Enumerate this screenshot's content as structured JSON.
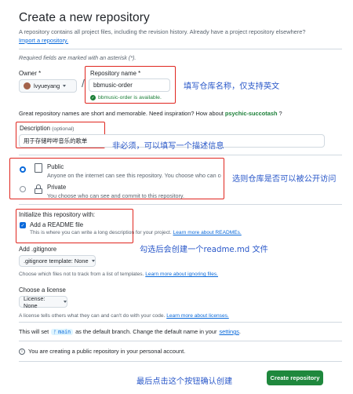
{
  "header": {
    "title": "Create a new repository",
    "description": "A repository contains all project files, including the revision history. Already have a project repository elsewhere?",
    "import_link": "Import a repository."
  },
  "required_note": "Required fields are marked with an asterisk (*).",
  "owner": {
    "label": "Owner *",
    "value": "lvyueyang"
  },
  "repo_name": {
    "label": "Repository name *",
    "value": "bbmusic-order",
    "availability": "bbmusic-order is available."
  },
  "name_hint": {
    "text": "Great repository names are short and memorable. Need inspiration? How about",
    "suggestion": "psychic-succotash",
    "end": "?"
  },
  "description_field": {
    "label": "Description",
    "optional": "(optional)",
    "value": "用于存储哔哔音乐的歌单"
  },
  "visibility": {
    "public_label": "Public",
    "public_desc": "Anyone on the internet can see this repository. You choose who can commit.",
    "private_label": "Private",
    "private_desc": "You choose who can see and commit to this repository."
  },
  "initialize": {
    "title": "Initialize this repository with:",
    "readme_label": "Add a README file",
    "readme_desc": "This is where you can write a long description for your project.",
    "readme_link": "Learn more about READMEs."
  },
  "gitignore": {
    "title": "Add .gitignore",
    "select": ".gitignore template: None",
    "desc": "Choose which files not to track from a list of templates.",
    "link": "Learn more about ignoring files."
  },
  "license": {
    "title": "Choose a license",
    "select": "License: None",
    "desc": "A license tells others what they can and can't do with your code.",
    "link": "Learn more about licenses."
  },
  "branch_note": {
    "pre": "This will set",
    "branch": "main",
    "post": "as the default branch. Change the default name in your",
    "link": "settings",
    "end": "."
  },
  "info_note": "You are creating a public repository in your personal account.",
  "create_button": "Create repository",
  "annotations": {
    "name": "填写仓库名称，仅支持英文",
    "desc": "非必须，可以填写一个描述信息",
    "visibility": "选则仓库是否可以被公开访问",
    "readme": "勾选后会创建一个readme.md 文件",
    "create": "最后点击这个按钮确认创建"
  },
  "colors": {
    "annotation_border": "#e0261f",
    "annotation_text": "#2a58c9",
    "primary_button": "#1f883d",
    "link": "#0969da"
  }
}
